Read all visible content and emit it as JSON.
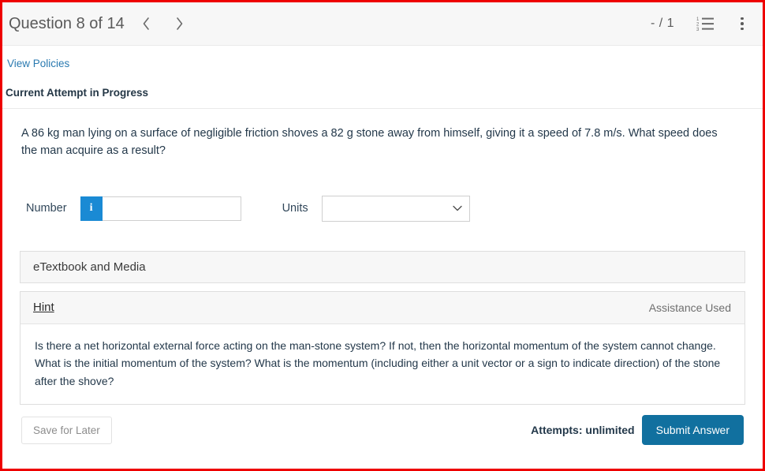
{
  "header": {
    "title": "Question 8 of 14",
    "prev_icon": "chevron-left-icon",
    "next_icon": "chevron-right-icon",
    "score": "- / 1",
    "list_icon": "numbered-list-icon",
    "menu_icon": "vertical-dots-icon",
    "list_icon_digits": [
      "1",
      "2",
      "3"
    ],
    "header_bg": "#f7f7f7"
  },
  "policies": {
    "link_label": "View Policies",
    "link_color": "#2a7ab0"
  },
  "attempt": {
    "status_label": "Current Attempt in Progress"
  },
  "question": {
    "text": "A 86 kg man lying on a surface of negligible friction shoves a 82 g stone away from himself, giving it a speed of 7.8 m/s. What speed does the man acquire as a result?"
  },
  "answer": {
    "number_label": "Number",
    "info_badge": "i",
    "info_badge_color": "#1a8ad4",
    "number_value": "",
    "number_placeholder": "",
    "units_label": "Units",
    "units_selected": "",
    "units_options": [
      ""
    ],
    "chevron_icon": "chevron-down-icon"
  },
  "panels": {
    "etextbook_label": "eTextbook and Media",
    "hint_label": "Hint",
    "assistance_label": "Assistance Used",
    "hint_text": "Is there a net horizontal external force acting on the man-stone system? If not, then the horizontal momentum of the system cannot change. What is the initial momentum of the system? What is the momentum (including either a unit vector or a sign to indicate direction) of the stone after the shove?"
  },
  "footer": {
    "save_label": "Save for Later",
    "attempts_label": "Attempts: unlimited",
    "submit_label": "Submit Answer",
    "submit_color": "#11709f"
  },
  "frame": {
    "border_color": "#ee0000"
  }
}
